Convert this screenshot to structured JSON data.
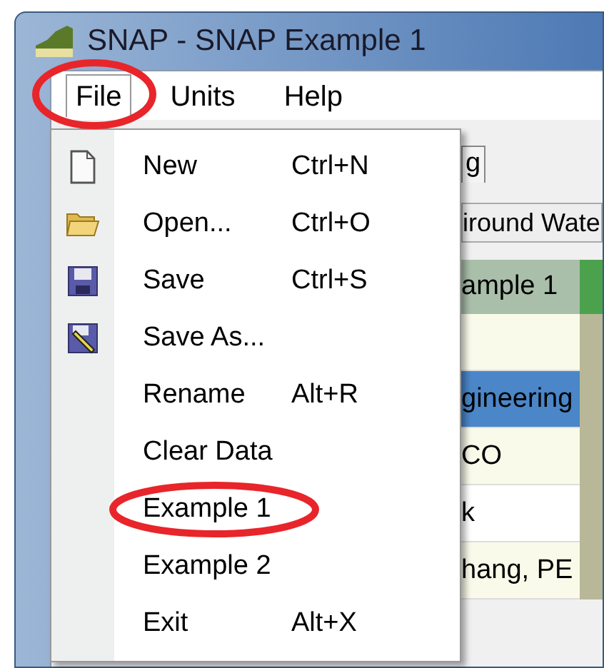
{
  "window": {
    "title": "SNAP - SNAP Example 1"
  },
  "menu_bar": [
    {
      "label": "File",
      "open": true,
      "circled": true
    },
    {
      "label": "Units",
      "open": false,
      "circled": false
    },
    {
      "label": "Help",
      "open": false,
      "circled": false
    }
  ],
  "file_menu": [
    {
      "kind": "new",
      "label": "New",
      "shortcut": "Ctrl+N",
      "circled": false
    },
    {
      "kind": "open",
      "label": "Open...",
      "shortcut": "Ctrl+O",
      "circled": false
    },
    {
      "kind": "save",
      "label": "Save",
      "shortcut": "Ctrl+S",
      "circled": false
    },
    {
      "kind": "saveas",
      "label": "Save As...",
      "circled": false
    },
    {
      "kind": "plain",
      "label": "Rename",
      "shortcut": "Alt+R",
      "circled": false
    },
    {
      "kind": "plain",
      "label": "Clear Data",
      "circled": false
    },
    {
      "kind": "plain",
      "label": "Example 1",
      "circled": true
    },
    {
      "kind": "plain",
      "label": "Example 2",
      "circled": false
    },
    {
      "kind": "plain",
      "label": "Exit",
      "shortcut": "Alt+X",
      "circled": false
    }
  ],
  "background": {
    "tab": "g",
    "subtab": "iround Wate",
    "table": {
      "header": "ample 1",
      "rows": [
        {
          "text": "",
          "selected": false
        },
        {
          "text": "gineering",
          "selected": true
        },
        {
          "text": "CO",
          "selected": false
        },
        {
          "text": "k",
          "selected": false
        },
        {
          "text": "hang, PE",
          "selected": false
        }
      ]
    }
  }
}
